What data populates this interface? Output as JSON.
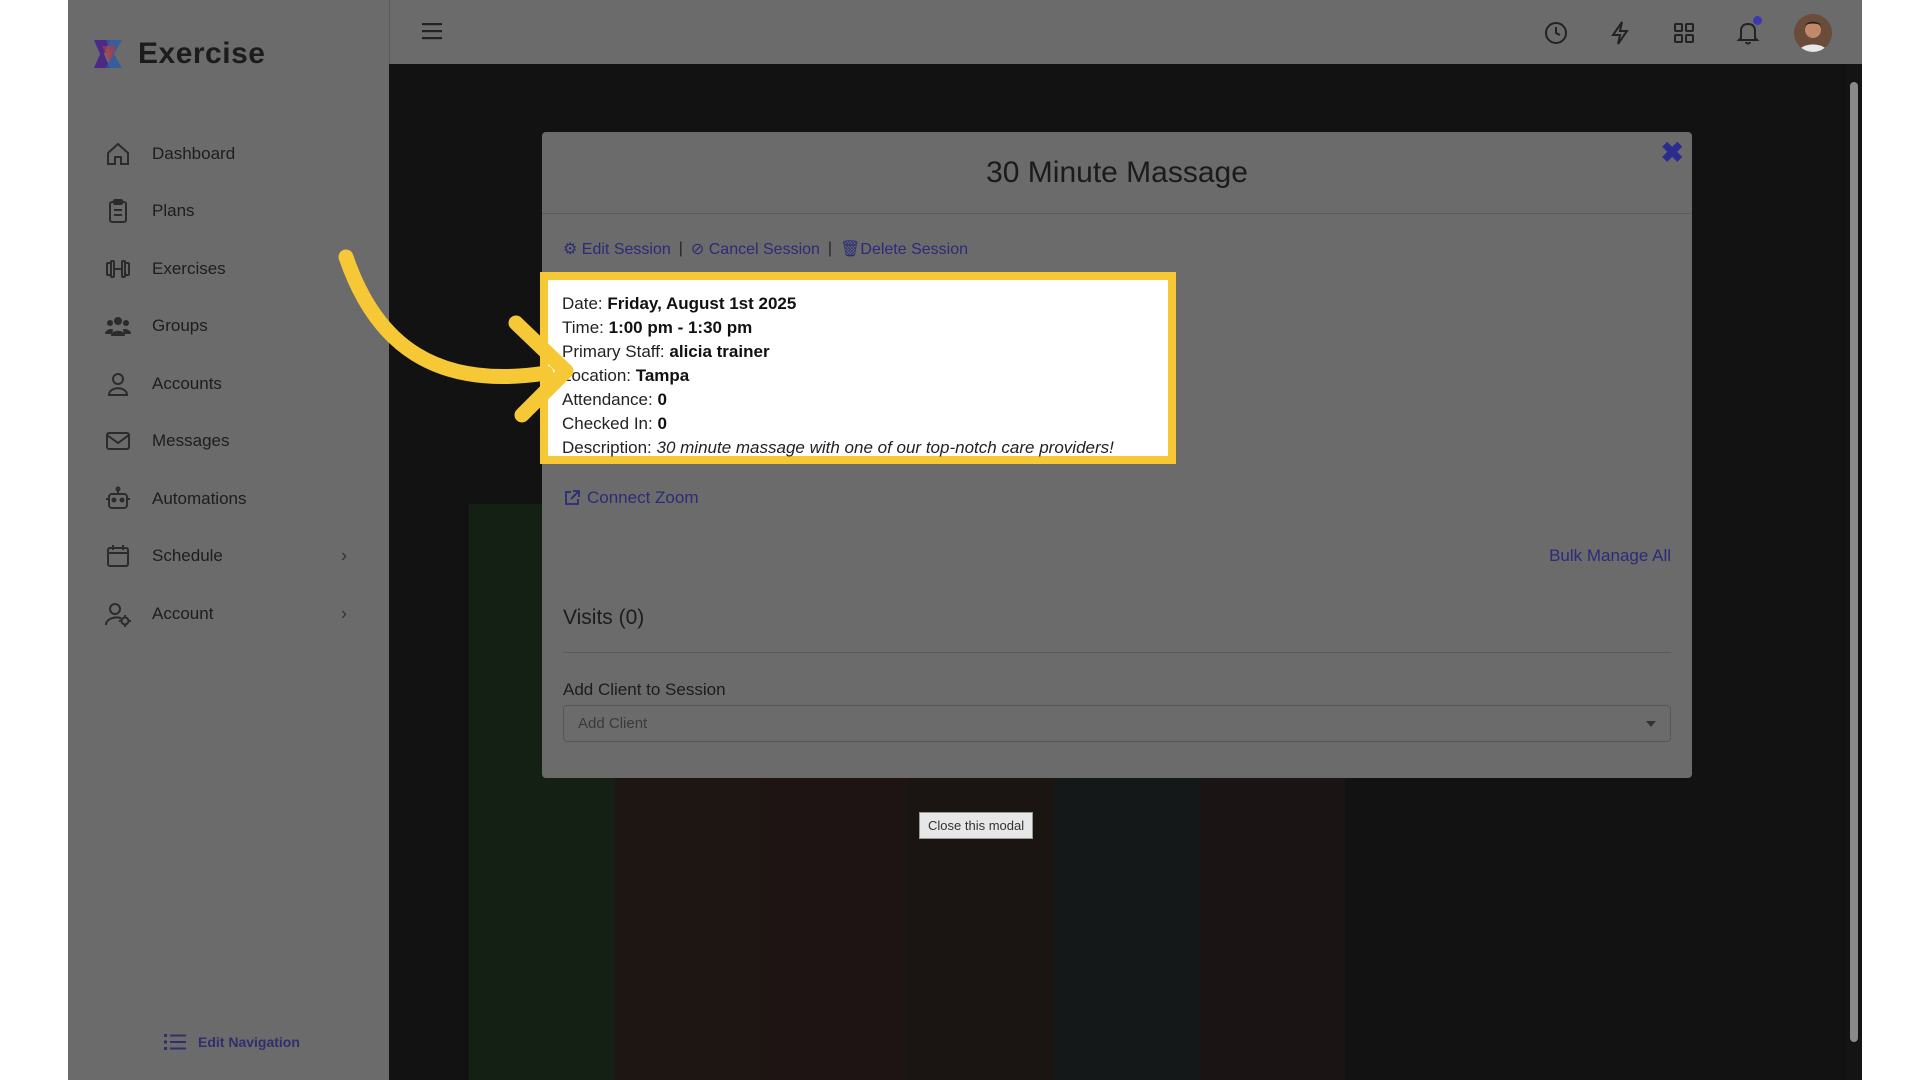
{
  "app": {
    "brand": "Exercise"
  },
  "sidebar": {
    "items": [
      {
        "label": "Dashboard",
        "icon": "home-icon"
      },
      {
        "label": "Plans",
        "icon": "clipboard-icon"
      },
      {
        "label": "Exercises",
        "icon": "dumbbell-icon"
      },
      {
        "label": "Groups",
        "icon": "users-icon"
      },
      {
        "label": "Accounts",
        "icon": "user-icon"
      },
      {
        "label": "Messages",
        "icon": "mail-icon"
      },
      {
        "label": "Automations",
        "icon": "robot-icon"
      },
      {
        "label": "Schedule",
        "icon": "calendar-icon",
        "has_submenu": true
      },
      {
        "label": "Account",
        "icon": "user-gear-icon",
        "has_submenu": true
      }
    ],
    "edit_navigation": "Edit Navigation"
  },
  "topbar": {
    "icons": [
      "menu-icon",
      "clock-icon",
      "bolt-icon",
      "apps-grid-icon",
      "bell-icon",
      "avatar"
    ]
  },
  "modal": {
    "title": "30 Minute Massage",
    "actions": {
      "edit": "Edit Session",
      "cancel": "Cancel Session",
      "delete": "Delete Session",
      "separator": "|"
    },
    "details": {
      "date_label": "Date:",
      "date_value": "Friday, August 1st 2025",
      "time_label": "Time:",
      "time_value": "1:00 pm - 1:30 pm",
      "staff_label": "Primary Staff:",
      "staff_value": "alicia trainer",
      "location_label": "Location:",
      "location_value": "Tampa",
      "attendance_label": "Attendance:",
      "attendance_value": "0",
      "checked_label": "Checked In:",
      "checked_value": "0",
      "description_label": "Description:",
      "description_value": "30 minute massage with one of our top-notch care providers!"
    },
    "connect_zoom": "Connect Zoom",
    "bulk_manage": "Bulk Manage All",
    "visits": "Visits (0)",
    "add_client_label": "Add Client to Session",
    "add_client_placeholder": "Add Client"
  },
  "tooltip": "Close this modal",
  "colors": {
    "highlight": "#f6c835",
    "accent": "#2b2b78",
    "arrow": "#f6c835"
  }
}
